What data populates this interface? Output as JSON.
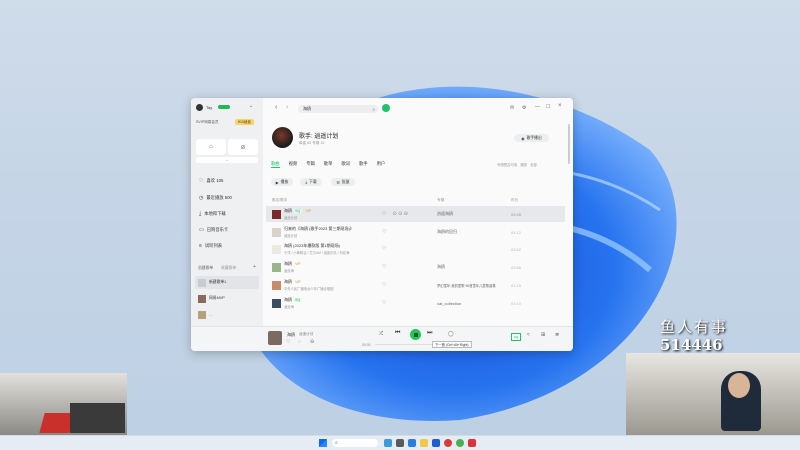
{
  "colors": {
    "accent": "#1ec26b",
    "tag_green": "#1db954",
    "tag_gold": "#d6a11f",
    "play": "#22c55e"
  },
  "sidebar": {
    "user_name": "Tay",
    "vip_text": "SVIP网易会员",
    "vip_btn": "¥10续费",
    "items": [
      {
        "label": "喜欢 105"
      },
      {
        "label": "最近播放 500"
      },
      {
        "label": "本地和下载"
      },
      {
        "label": "已购音乐卡"
      },
      {
        "label": "试听列表"
      }
    ],
    "section_label": "创建歌单",
    "section_tab": "收藏歌单",
    "playlists": [
      {
        "label": "新建歌单1"
      },
      {
        "label": "网易MVP"
      },
      {
        "label": "…"
      }
    ]
  },
  "search": {
    "value": "海鸥"
  },
  "artist": {
    "title": "歌手: 逍遥计划",
    "stats": "单曲 50   专辑 15",
    "follow_btn": "歌手播出"
  },
  "tabs": [
    "歌曲",
    "视频",
    "专辑",
    "歌单",
    "歌词",
    "歌手",
    "用户"
  ],
  "tabs_right": [
    "专辑是否可用",
    "播放",
    "全部"
  ],
  "actions": {
    "play": "播放",
    "download": "下载",
    "batch": "批量"
  },
  "table": {
    "headers": [
      "歌名/歌手",
      "专辑",
      "时长"
    ],
    "rows": [
      {
        "title": "海鸥",
        "sub": "逍遥计划",
        "album": "逍遥海鸥",
        "time": "03:45"
      },
      {
        "title": "归来的《海鸥 (歌手2023 第三期现场)》",
        "sub": "逍遥计划",
        "album": "海鸥的回归",
        "time": "04:12"
      },
      {
        "title": "海鸥 (2023年爆款版 第1期现场)",
        "sub": "于洋 / 小黄鸭合 / 艾尔AM / 逍遥乐队 / 刘欢海",
        "album": "",
        "time": "03:52"
      },
      {
        "title": "海鸥",
        "sub": "逍遥海",
        "album": "海鸥",
        "time": "03:58"
      },
      {
        "title": "海鸥",
        "sub": "中央人民广播电台少年广播合唱团",
        "album": "梦幻童年·我的童歌·50首童年儿童歌曲集",
        "time": "01:15"
      },
      {
        "title": "海鸥",
        "sub": "逍遥海",
        "album": "cat_collection",
        "time": "03:10"
      }
    ]
  },
  "player": {
    "song": "海鸥",
    "artist": "逍遥计划",
    "time_now": "00:00",
    "time_total": "03:45",
    "tooltip": "下一首 (Ctrl+Alt+Right)"
  },
  "stream": {
    "title": "鱼人有事",
    "id": "514446"
  }
}
